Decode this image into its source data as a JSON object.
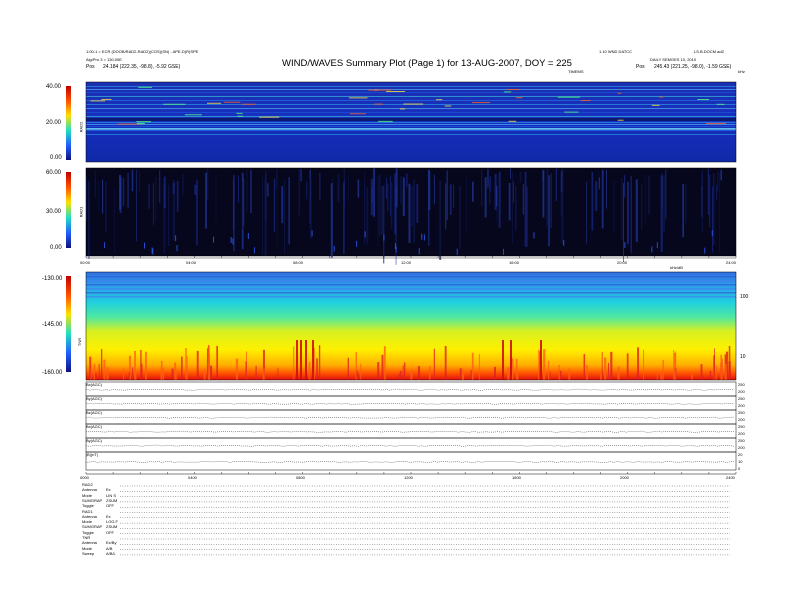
{
  "header": {
    "title": "WIND/WAVES Summary Plot (Page 1) for 13-AUG-2007, DOY = 225",
    "left_line1": "1:00-1 = ECR (DOOB/RAD2-RAD2)(COS)(SN) - APE-D(R)SPE",
    "left_line2": "Alg/Pro 3 = 130.00E",
    "left_pos_label": "Pos",
    "left_pos_value": "24.184 (222.35, -98.8), -5.92 GSE)",
    "center_small": "TIMEMS",
    "right_line1": "1.10 WND DATCC",
    "right_line1b": "LS.B.DOCM adZ",
    "right_line2": "DAILY SEMGES 10, 2010",
    "right_pos_label": "Pos",
    "right_pos_value": "245.43 (221.25, -98.0), -1.59 GSE)",
    "right_corner": "kHz"
  },
  "panels": {
    "rad2": {
      "name": "RAD2",
      "yticks": [
        "40.00",
        "20.00",
        "0.00"
      ]
    },
    "rad1": {
      "name": "RAD1",
      "yticks": [
        "60.00",
        "30.00",
        "0.00"
      ]
    },
    "tnr": {
      "name": "TNR",
      "yticks": [
        "-130.00",
        "-145.00",
        "-160.00"
      ],
      "right_ticks": [
        "100",
        "10"
      ]
    }
  },
  "time_axis_top": [
    "00:00",
    "04:00",
    "08:00",
    "12:00",
    "16:00",
    "20:00",
    "24:00"
  ],
  "time_axis_top_note": "kHz/dB",
  "time_axis_bottom": [
    "0000",
    "0400",
    "0800",
    "1200",
    "1600",
    "2000",
    "2400"
  ],
  "line_panels": [
    {
      "name": "Bx(AGC)",
      "ticks": [
        "250",
        "200"
      ]
    },
    {
      "name": "By(AGC)",
      "ticks": [
        "250",
        "200"
      ]
    },
    {
      "name": "Bz(AGC)",
      "ticks": [
        "250",
        "200"
      ]
    },
    {
      "name": "Bx(AGC)",
      "ticks": [
        "250",
        "200"
      ]
    },
    {
      "name": "By(AGC)",
      "ticks": [
        "250",
        "200"
      ]
    },
    {
      "name": "|B|(nT)",
      "ticks": [
        "20",
        "10",
        "0"
      ]
    }
  ],
  "info_block": [
    {
      "label": "RAD2",
      "value": ""
    },
    {
      "label": "Antenna",
      "value": "Ex"
    },
    {
      "label": "Mode",
      "value": "LIN S"
    },
    {
      "label": "SUMGRAP",
      "value": "ZSUM"
    },
    {
      "label": "Toggle",
      "value": "OFF"
    },
    {
      "label": "RAD1",
      "value": ""
    },
    {
      "label": "Antenna",
      "value": "Ex"
    },
    {
      "label": "Mode",
      "value": "LOG F"
    },
    {
      "label": "SUMGRAP",
      "value": "ZSUM"
    },
    {
      "label": "Toggle",
      "value": "OFF"
    },
    {
      "label": "TNR",
      "value": ""
    },
    {
      "label": "Antenna",
      "value": "Ex/By"
    },
    {
      "label": "Mode",
      "value": "A/B"
    },
    {
      "label": "Sweep",
      "value": "A/B/L"
    }
  ],
  "colors": {
    "spectrogram_low": "#1a2fb0",
    "spectrogram_high": "#d01010",
    "rad1_background": "#05051e",
    "tnr_top": "#2c8ae0",
    "tnr_bottom": "#e02020"
  },
  "chart_data": {
    "type": "heatmap",
    "title": "WIND/WAVES Summary Plot (Page 1) for 13-AUG-2007, DOY = 225",
    "x": [
      "00:00",
      "04:00",
      "08:00",
      "12:00",
      "16:00",
      "20:00",
      "24:00"
    ],
    "series": [
      {
        "name": "RAD2",
        "ylim": [
          0,
          40
        ]
      },
      {
        "name": "RAD1",
        "ylim": [
          0,
          60
        ]
      },
      {
        "name": "TNR",
        "ylim": [
          -160,
          -130
        ]
      }
    ]
  }
}
